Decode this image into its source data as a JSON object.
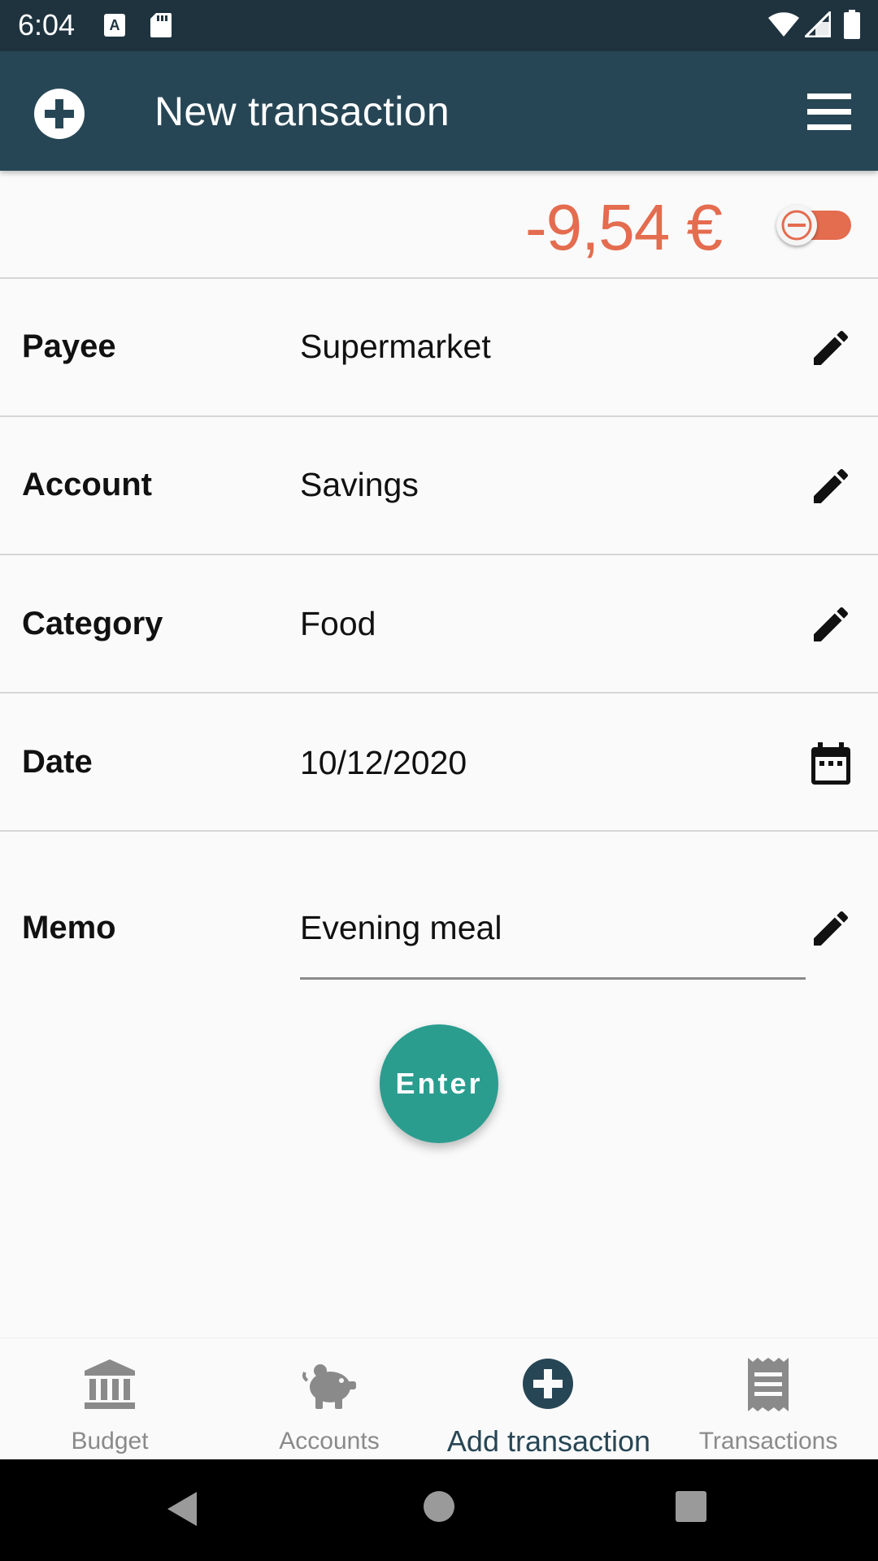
{
  "status_bar": {
    "time": "6:04",
    "icons": [
      "keyboard-a-icon",
      "sd-card-icon",
      "wifi-icon",
      "cell-signal-icon",
      "battery-icon"
    ]
  },
  "app_bar": {
    "title": "New transaction",
    "left_icon": "add-circle-icon",
    "right_icon": "menu-icon"
  },
  "amount": {
    "value": "-9,54 €",
    "sign_toggle": "negative",
    "color": "#e46c4f"
  },
  "fields": [
    {
      "label": "Payee",
      "value": "Supermarket",
      "icon": "edit-icon"
    },
    {
      "label": "Account",
      "value": "Savings",
      "icon": "edit-icon"
    },
    {
      "label": "Category",
      "value": "Food",
      "icon": "edit-icon"
    },
    {
      "label": "Date",
      "value": "10/12/2020",
      "icon": "calendar-icon"
    },
    {
      "label": "Memo",
      "value": "Evening meal",
      "icon": "edit-icon"
    }
  ],
  "enter_button": {
    "label": "Enter",
    "color": "#2a9d8f"
  },
  "bottom_nav": {
    "items": [
      {
        "label": "Budget",
        "icon": "bank-icon",
        "active": false
      },
      {
        "label": "Accounts",
        "icon": "piggy-bank-icon",
        "active": false
      },
      {
        "label": "Add transaction",
        "icon": "add-circle-icon",
        "active": true
      },
      {
        "label": "Transactions",
        "icon": "receipt-icon",
        "active": false
      }
    ]
  },
  "colors": {
    "status_bar": "#1f333f",
    "app_bar": "#274655",
    "accent": "#2a9d8f",
    "negative": "#e46c4f"
  }
}
